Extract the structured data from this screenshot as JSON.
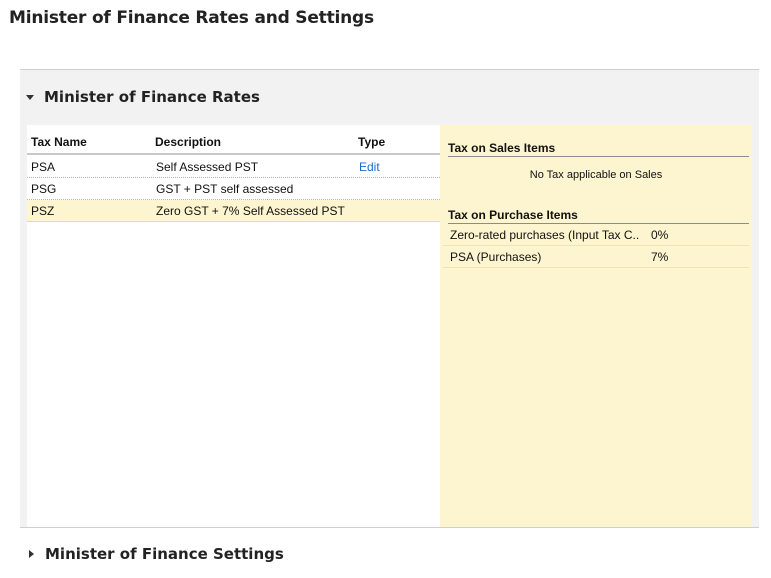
{
  "page": {
    "title": "Minister of Finance Rates and Settings"
  },
  "rates_section": {
    "title": "Minister of Finance Rates",
    "table": {
      "headers": {
        "tax_name": "Tax Name",
        "description": "Description",
        "type": "Type"
      },
      "rows": [
        {
          "tax_name": "PSA",
          "description": "Self Assessed PST",
          "type": "Edit"
        },
        {
          "tax_name": "PSG",
          "description": "GST + PST self assessed",
          "type": ""
        },
        {
          "tax_name": "PSZ",
          "description": "Zero GST + 7% Self Assessed PST",
          "type": ""
        }
      ],
      "selected_row": 2
    },
    "details": {
      "sales_title": "Tax on Sales Items",
      "sales_note": "No Tax applicable on Sales",
      "purchase_title": "Tax on Purchase Items",
      "purchase_items": [
        {
          "name": "Zero-rated purchases (Input Tax C...",
          "rate": "0%"
        },
        {
          "name": "PSA (Purchases)",
          "rate": "7%"
        }
      ]
    }
  },
  "settings_section": {
    "title": "Minister of Finance Settings"
  }
}
